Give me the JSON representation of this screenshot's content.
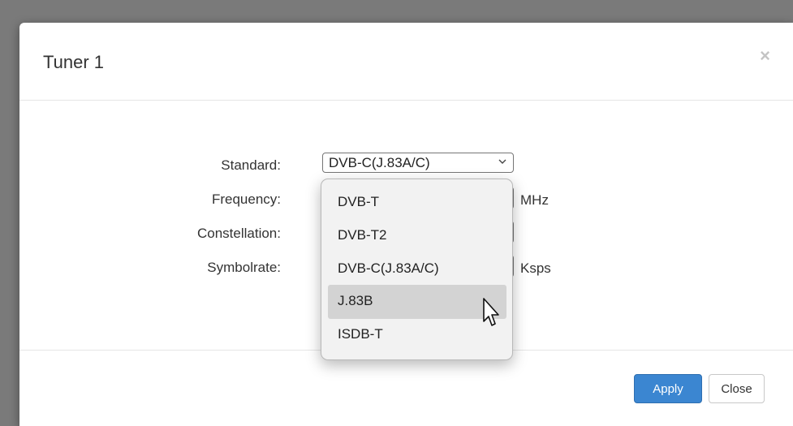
{
  "dialog": {
    "title": "Tuner 1",
    "close_icon": "×"
  },
  "form": {
    "standard_label": "Standard:",
    "frequency_label": "Frequency:",
    "constellation_label": "Constellation:",
    "symbolrate_label": "Symbolrate:",
    "standard_value": "DVB-C(J.83A/C)",
    "frequency_unit": "MHz",
    "symbolrate_unit": "Ksps"
  },
  "dropdown": {
    "options": [
      "DVB-T",
      "DVB-T2",
      "DVB-C(J.83A/C)",
      "J.83B",
      "ISDB-T"
    ],
    "hovered_option": "J.83B"
  },
  "footer": {
    "apply_label": "Apply",
    "close_label": "Close"
  },
  "icons": {
    "select_chevron": "chevron-down-icon",
    "dialog_close": "close-icon",
    "pointer": "mouse-cursor-icon"
  },
  "colors": {
    "primary_button": "#3b86d1",
    "backdrop": "#7a7a7a",
    "dropdown_hover": "#d3d3d3"
  }
}
